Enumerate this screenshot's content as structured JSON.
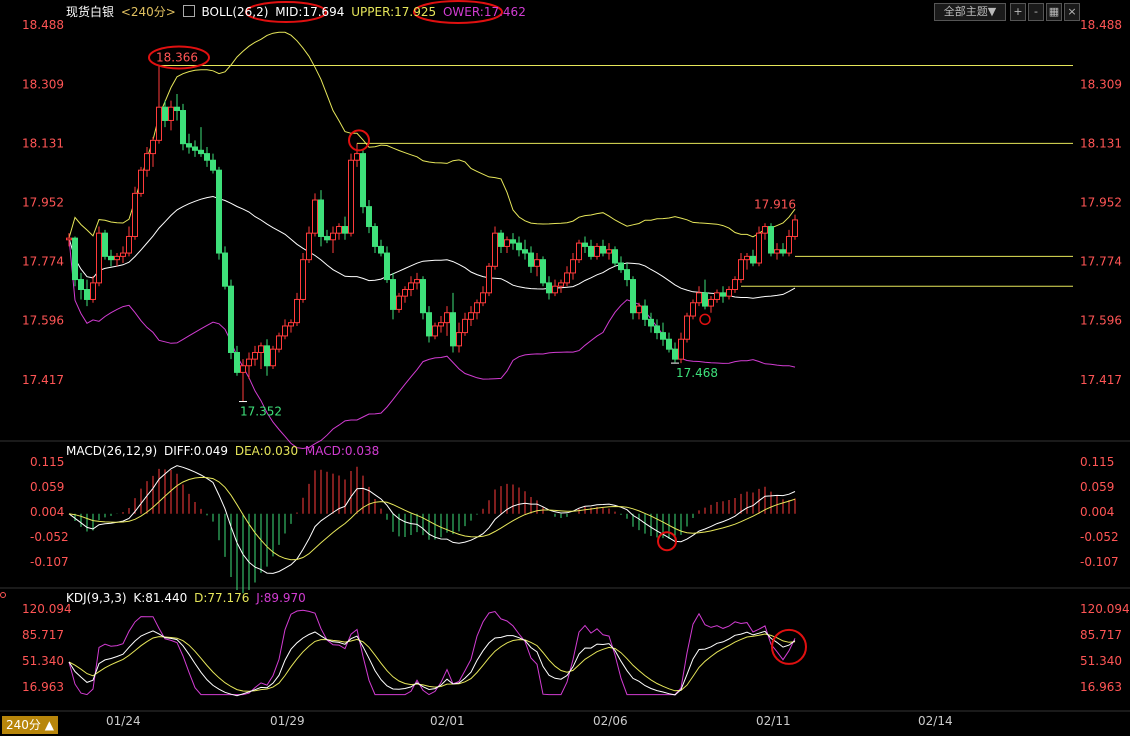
{
  "header": {
    "instrument": "现货白银",
    "period_tag": "<240分>",
    "boll_label": "BOLL(26,2)",
    "mid": "MID:17.694",
    "upper": "UPPER:17.925",
    "lower": "OWER:17.462",
    "theme_button": "全部主题▼"
  },
  "macd_header": {
    "label": "MACD(26,12,9)",
    "diff": "DIFF:0.049",
    "dea": "DEA:0.030",
    "macd": "MACD:0.038"
  },
  "kdj_header": {
    "label": "KDJ(9,3,3)",
    "k": "K:81.440",
    "d": "D:77.176",
    "j": "J:89.970"
  },
  "footer": {
    "period_button": "240分 ▲",
    "dates": [
      "01/24",
      "01/29",
      "02/01",
      "02/06",
      "02/11",
      "02/14"
    ]
  },
  "colors": {
    "up": "#ff3b3b",
    "down": "#3ee07a",
    "mid_line": "#ffffff",
    "upper_line": "#e6e65a",
    "lower_line": "#d23cd2",
    "annotation": "#e01010",
    "axis_text": "#ff5555"
  },
  "chart_data": [
    {
      "type": "candlestick",
      "title": "BOLL(26,2)",
      "yticks": [
        "18.488",
        "18.309",
        "18.131",
        "17.952",
        "17.774",
        "17.596",
        "17.417"
      ],
      "ylim": [
        17.31,
        18.52
      ],
      "annotations": [
        "18.366",
        "17.352",
        "17.468",
        "17.916"
      ],
      "ohlc": [
        [
          17.84,
          17.86,
          17.82,
          17.845
        ],
        [
          17.845,
          17.85,
          17.7,
          17.72
        ],
        [
          17.72,
          17.74,
          17.66,
          17.69
        ],
        [
          17.69,
          17.72,
          17.64,
          17.66
        ],
        [
          17.66,
          17.73,
          17.65,
          17.71
        ],
        [
          17.71,
          17.88,
          17.7,
          17.86
        ],
        [
          17.86,
          17.87,
          17.78,
          17.79
        ],
        [
          17.79,
          17.81,
          17.76,
          17.78
        ],
        [
          17.78,
          17.8,
          17.76,
          17.79
        ],
        [
          17.79,
          17.82,
          17.77,
          17.8
        ],
        [
          17.8,
          17.88,
          17.79,
          17.85
        ],
        [
          17.85,
          18.0,
          17.84,
          17.98
        ],
        [
          17.98,
          18.06,
          17.97,
          18.05
        ],
        [
          18.05,
          18.12,
          18.03,
          18.1
        ],
        [
          18.1,
          18.15,
          18.06,
          18.14
        ],
        [
          18.14,
          18.366,
          18.13,
          18.24
        ],
        [
          18.24,
          18.26,
          18.18,
          18.2
        ],
        [
          18.2,
          18.26,
          18.17,
          18.24
        ],
        [
          18.24,
          18.28,
          18.2,
          18.23
        ],
        [
          18.23,
          18.25,
          18.11,
          18.13
        ],
        [
          18.13,
          18.16,
          18.1,
          18.12
        ],
        [
          18.12,
          18.14,
          18.09,
          18.11
        ],
        [
          18.11,
          18.18,
          18.09,
          18.1
        ],
        [
          18.1,
          18.12,
          18.06,
          18.08
        ],
        [
          18.08,
          18.1,
          18.04,
          18.05
        ],
        [
          18.05,
          18.06,
          17.78,
          17.8
        ],
        [
          17.8,
          17.82,
          17.69,
          17.7
        ],
        [
          17.7,
          17.72,
          17.48,
          17.5
        ],
        [
          17.5,
          17.52,
          17.43,
          17.44
        ],
        [
          17.44,
          17.48,
          17.352,
          17.46
        ],
        [
          17.46,
          17.5,
          17.42,
          17.48
        ],
        [
          17.48,
          17.52,
          17.46,
          17.5
        ],
        [
          17.5,
          17.53,
          17.45,
          17.52
        ],
        [
          17.52,
          17.54,
          17.43,
          17.46
        ],
        [
          17.46,
          17.52,
          17.45,
          17.51
        ],
        [
          17.51,
          17.56,
          17.5,
          17.55
        ],
        [
          17.55,
          17.6,
          17.54,
          17.58
        ],
        [
          17.58,
          17.6,
          17.56,
          17.59
        ],
        [
          17.59,
          17.68,
          17.58,
          17.66
        ],
        [
          17.66,
          17.8,
          17.65,
          17.78
        ],
        [
          17.78,
          17.88,
          17.77,
          17.86
        ],
        [
          17.86,
          17.98,
          17.85,
          17.96
        ],
        [
          17.96,
          17.99,
          17.82,
          17.85
        ],
        [
          17.85,
          17.87,
          17.83,
          17.84
        ],
        [
          17.84,
          17.88,
          17.8,
          17.86
        ],
        [
          17.86,
          17.89,
          17.84,
          17.88
        ],
        [
          17.88,
          17.91,
          17.84,
          17.86
        ],
        [
          17.86,
          18.1,
          17.85,
          18.08
        ],
        [
          18.08,
          18.131,
          18.06,
          18.1
        ],
        [
          18.1,
          18.11,
          17.92,
          17.94
        ],
        [
          17.94,
          17.96,
          17.86,
          17.88
        ],
        [
          17.88,
          17.89,
          17.8,
          17.82
        ],
        [
          17.82,
          17.84,
          17.79,
          17.8
        ],
        [
          17.8,
          17.82,
          17.71,
          17.72
        ],
        [
          17.72,
          17.74,
          17.6,
          17.63
        ],
        [
          17.63,
          17.68,
          17.62,
          17.67
        ],
        [
          17.67,
          17.7,
          17.65,
          17.69
        ],
        [
          17.69,
          17.73,
          17.67,
          17.71
        ],
        [
          17.71,
          17.74,
          17.69,
          17.72
        ],
        [
          17.72,
          17.73,
          17.6,
          17.62
        ],
        [
          17.62,
          17.64,
          17.53,
          17.55
        ],
        [
          17.55,
          17.59,
          17.54,
          17.58
        ],
        [
          17.58,
          17.61,
          17.56,
          17.59
        ],
        [
          17.59,
          17.64,
          17.55,
          17.62
        ],
        [
          17.62,
          17.68,
          17.5,
          17.52
        ],
        [
          17.52,
          17.59,
          17.5,
          17.56
        ],
        [
          17.56,
          17.62,
          17.55,
          17.6
        ],
        [
          17.6,
          17.64,
          17.58,
          17.62
        ],
        [
          17.62,
          17.66,
          17.6,
          17.65
        ],
        [
          17.65,
          17.7,
          17.64,
          17.68
        ],
        [
          17.68,
          17.77,
          17.67,
          17.76
        ],
        [
          17.76,
          17.88,
          17.75,
          17.86
        ],
        [
          17.86,
          17.87,
          17.8,
          17.82
        ],
        [
          17.82,
          17.85,
          17.8,
          17.84
        ],
        [
          17.84,
          17.86,
          17.81,
          17.83
        ],
        [
          17.83,
          17.85,
          17.79,
          17.81
        ],
        [
          17.81,
          17.84,
          17.78,
          17.8
        ],
        [
          17.8,
          17.82,
          17.74,
          17.76
        ],
        [
          17.76,
          17.8,
          17.73,
          17.78
        ],
        [
          17.78,
          17.79,
          17.7,
          17.71
        ],
        [
          17.71,
          17.73,
          17.66,
          17.68
        ],
        [
          17.68,
          17.72,
          17.67,
          17.7
        ],
        [
          17.7,
          17.72,
          17.68,
          17.71
        ],
        [
          17.71,
          17.76,
          17.7,
          17.74
        ],
        [
          17.74,
          17.8,
          17.72,
          17.78
        ],
        [
          17.78,
          17.84,
          17.77,
          17.83
        ],
        [
          17.83,
          17.85,
          17.8,
          17.82
        ],
        [
          17.82,
          17.84,
          17.78,
          17.79
        ],
        [
          17.79,
          17.83,
          17.78,
          17.82
        ],
        [
          17.82,
          17.84,
          17.79,
          17.8
        ],
        [
          17.8,
          17.83,
          17.78,
          17.81
        ],
        [
          17.81,
          17.82,
          17.76,
          17.77
        ],
        [
          17.77,
          17.79,
          17.74,
          17.75
        ],
        [
          17.75,
          17.77,
          17.7,
          17.72
        ],
        [
          17.72,
          17.73,
          17.6,
          17.62
        ],
        [
          17.62,
          17.65,
          17.6,
          17.64
        ],
        [
          17.64,
          17.66,
          17.58,
          17.6
        ],
        [
          17.6,
          17.62,
          17.56,
          17.58
        ],
        [
          17.58,
          17.6,
          17.54,
          17.56
        ],
        [
          17.56,
          17.59,
          17.52,
          17.54
        ],
        [
          17.54,
          17.56,
          17.5,
          17.51
        ],
        [
          17.51,
          17.53,
          17.47,
          17.48
        ],
        [
          17.48,
          17.56,
          17.468,
          17.54
        ],
        [
          17.54,
          17.62,
          17.53,
          17.61
        ],
        [
          17.61,
          17.66,
          17.6,
          17.65
        ],
        [
          17.65,
          17.7,
          17.64,
          17.68
        ],
        [
          17.68,
          17.72,
          17.63,
          17.64
        ],
        [
          17.64,
          17.67,
          17.62,
          17.66
        ],
        [
          17.66,
          17.69,
          17.65,
          17.68
        ],
        [
          17.68,
          17.7,
          17.65,
          17.67
        ],
        [
          17.67,
          17.7,
          17.66,
          17.69
        ],
        [
          17.69,
          17.73,
          17.68,
          17.72
        ],
        [
          17.72,
          17.8,
          17.71,
          17.78
        ],
        [
          17.78,
          17.8,
          17.75,
          17.79
        ],
        [
          17.79,
          17.81,
          17.76,
          17.77
        ],
        [
          17.77,
          17.88,
          17.76,
          17.86
        ],
        [
          17.86,
          17.89,
          17.84,
          17.88
        ],
        [
          17.88,
          17.89,
          17.79,
          17.8
        ],
        [
          17.8,
          17.83,
          17.78,
          17.81
        ],
        [
          17.81,
          17.83,
          17.79,
          17.8
        ],
        [
          17.8,
          17.87,
          17.79,
          17.85
        ],
        [
          17.85,
          17.916,
          17.84,
          17.9
        ]
      ]
    },
    {
      "type": "line",
      "title": "MACD(26,12,9)",
      "yticks": [
        "0.115",
        "0.059",
        "0.004",
        "-0.052",
        "-0.107"
      ],
      "series": [
        {
          "name": "DIFF"
        },
        {
          "name": "DEA"
        },
        {
          "name": "MACD"
        }
      ]
    },
    {
      "type": "line",
      "title": "KDJ(9,3,3)",
      "yticks": [
        "120.094",
        "85.717",
        "51.340",
        "16.963"
      ],
      "series": [
        {
          "name": "K"
        },
        {
          "name": "D"
        },
        {
          "name": "J"
        }
      ]
    }
  ]
}
